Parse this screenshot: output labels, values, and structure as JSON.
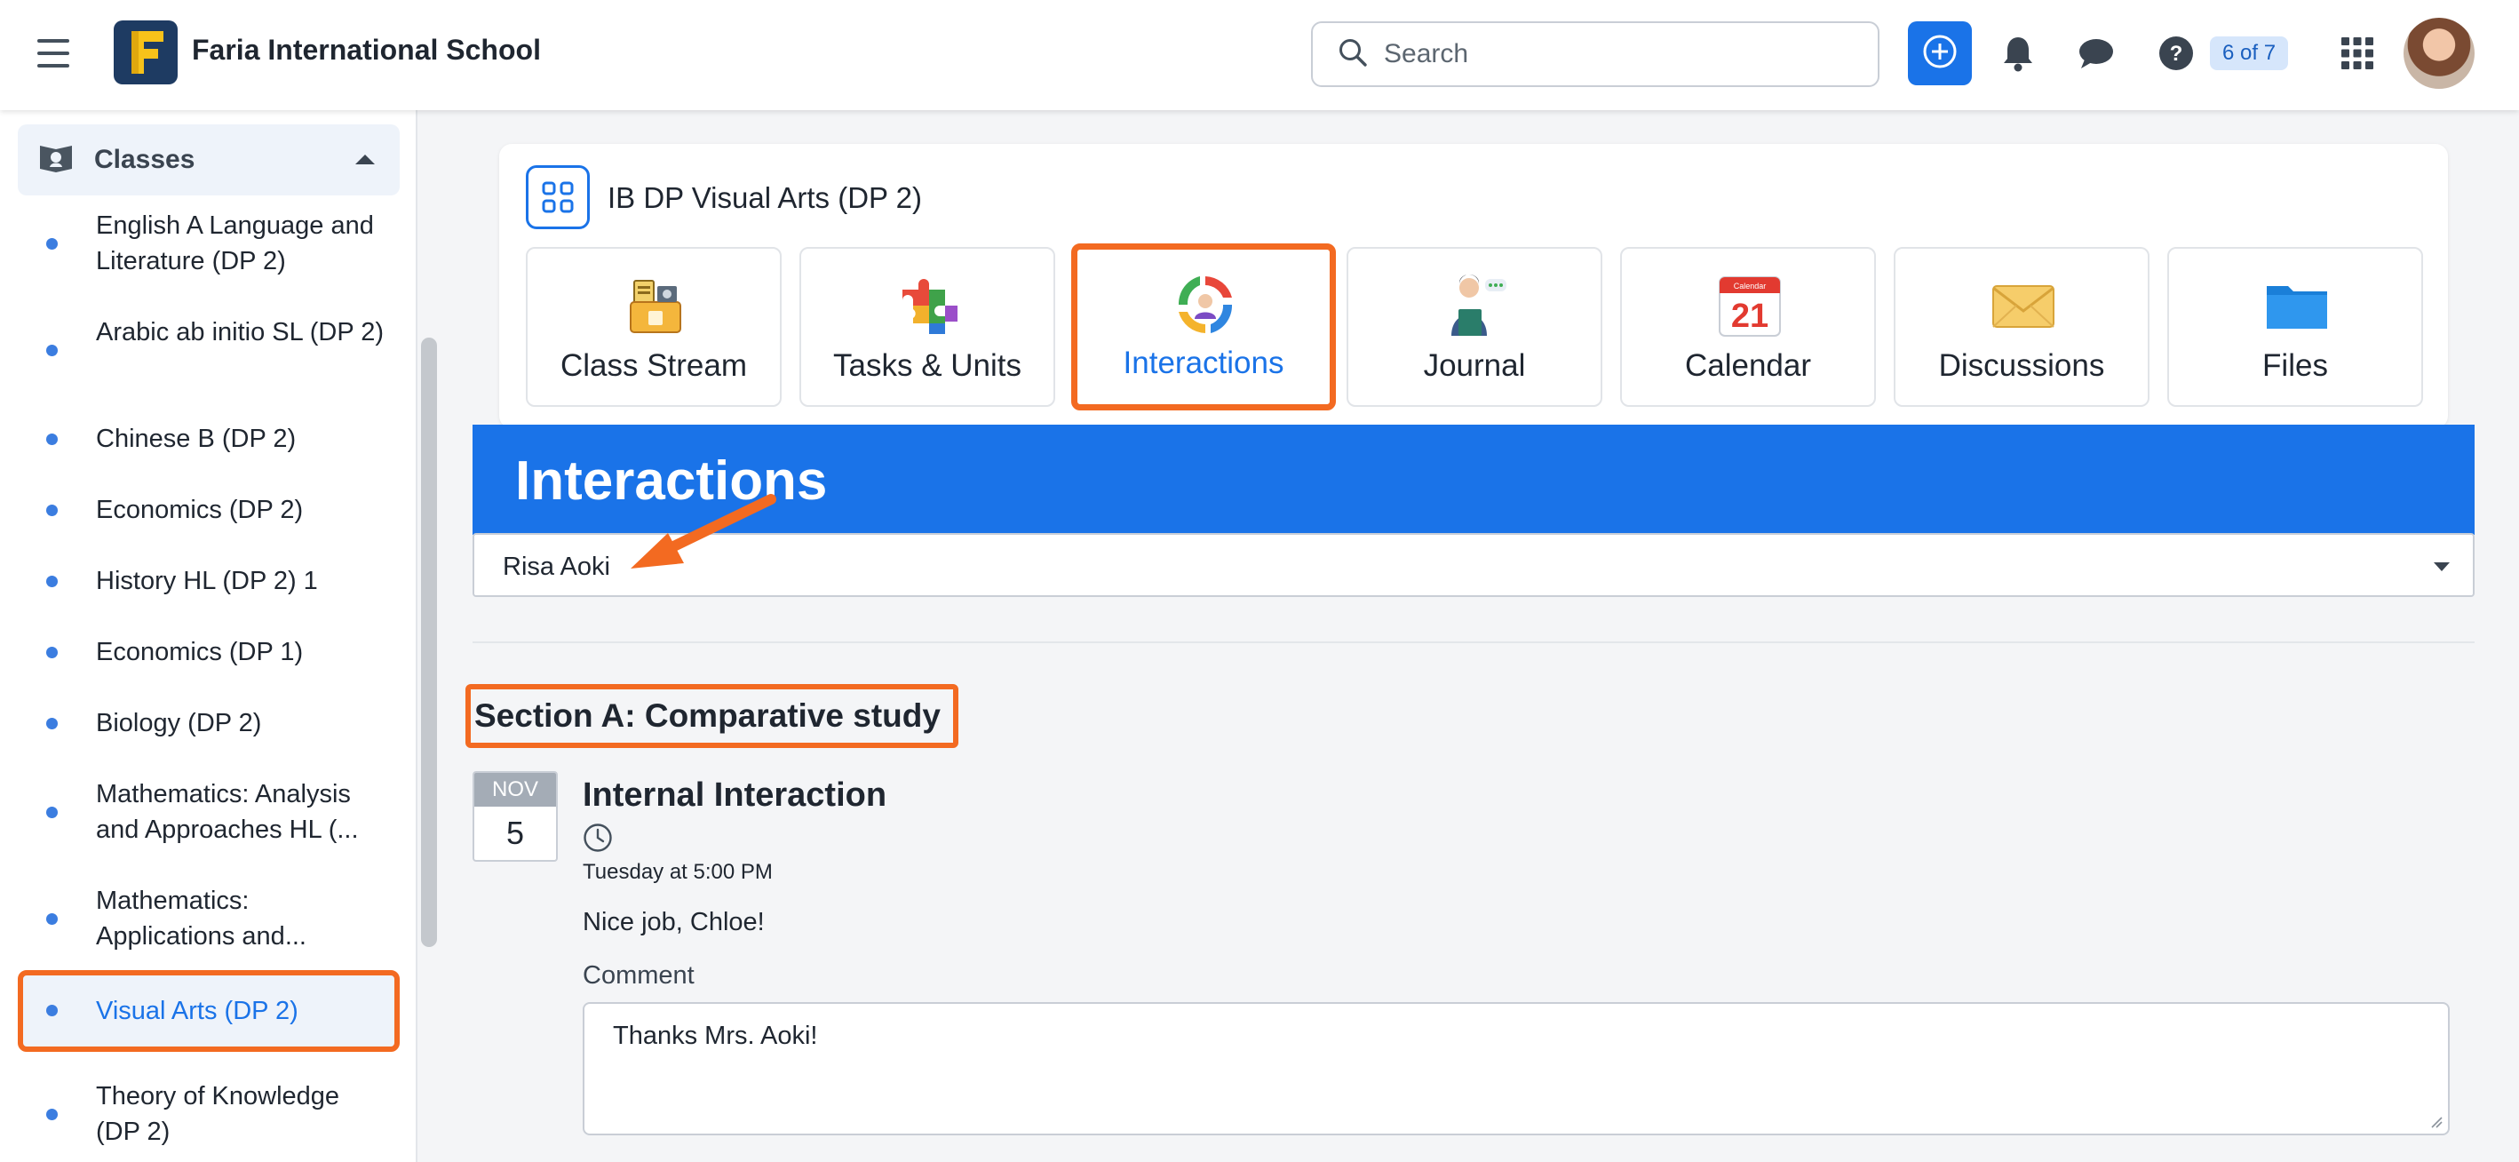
{
  "header": {
    "school_name": "Faria International School",
    "search_placeholder": "Search",
    "help_badge": "6 of 7",
    "icons": [
      "menu-icon",
      "add-icon",
      "bell-icon",
      "chat-icon",
      "help-icon",
      "apps-grid-icon"
    ]
  },
  "sidebar": {
    "section_label": "Classes",
    "items": [
      {
        "label": "English A Language and Literature (DP 2)"
      },
      {
        "label": "Arabic ab initio SL (DP 2)"
      },
      {
        "label": "Chinese B (DP 2)"
      },
      {
        "label": "Economics (DP 2)"
      },
      {
        "label": "History HL (DP 2) 1"
      },
      {
        "label": "Economics (DP 1)"
      },
      {
        "label": "Biology (DP 2)"
      },
      {
        "label": "Mathematics: Analysis and Approaches HL (..."
      },
      {
        "label": "Mathematics: Applications and..."
      },
      {
        "label": "Visual Arts (DP 2)",
        "active": true
      },
      {
        "label": "Theory of Knowledge (DP 2)"
      }
    ]
  },
  "class_card": {
    "title": "IB DP Visual Arts (DP 2)",
    "tabs": [
      {
        "label": "Class Stream",
        "icon": "class-stream-icon"
      },
      {
        "label": "Tasks & Units",
        "icon": "puzzle-icon"
      },
      {
        "label": "Interactions",
        "icon": "interactions-cycle-icon",
        "active": true
      },
      {
        "label": "Journal",
        "icon": "journal-icon"
      },
      {
        "label": "Calendar",
        "icon": "calendar-icon",
        "calendar_day": "21",
        "calendar_caption": "Calendar"
      },
      {
        "label": "Discussions",
        "icon": "envelope-icon"
      },
      {
        "label": "Files",
        "icon": "folder-icon"
      }
    ]
  },
  "page": {
    "heading": "Interactions",
    "student_select_value": "Risa Aoki",
    "section_title": "Section A: Comparative study"
  },
  "interaction": {
    "month": "NOV",
    "day": "5",
    "title": "Internal Interaction",
    "time": "Tuesday at 5:00 PM",
    "message": "Nice job, Chloe!",
    "comment_label": "Comment",
    "comment_text": "Thanks Mrs. Aoki!"
  },
  "colors": {
    "accent_blue": "#1a73e8",
    "highlight_orange": "#f36a21",
    "logo_navy": "#1e3b62",
    "logo_yellow": "#f7c21a"
  }
}
